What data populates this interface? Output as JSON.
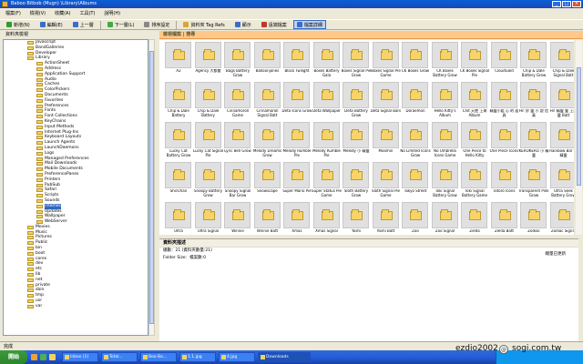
{
  "window": {
    "title": "Baboo Bitbob (Mugn) \\Library\\Albums"
  },
  "menu": [
    "檔案(F)",
    "檢視(V)",
    "收藏(A)",
    "工具(T)",
    "說明(H)"
  ],
  "toolbar": [
    {
      "label": "新增(N)",
      "icon": "new-icon",
      "color": "#2e9b2e"
    },
    {
      "label": "編輯(E)",
      "icon": "edit-icon",
      "color": "#3b6cc8"
    },
    {
      "label": "上一層",
      "icon": "up-icon",
      "color": "#3b6cc8"
    },
    {
      "label": "下一層(L)",
      "icon": "down-icon",
      "color": "#4a4"
    },
    {
      "label": "排序設定",
      "icon": "sort-icon",
      "color": "#888"
    },
    {
      "label": "資料夾 Tag Refs",
      "icon": "folder-tag-icon",
      "color": "#d9a630"
    },
    {
      "label": "顯示",
      "icon": "view-icon",
      "color": "#3b6cc8"
    },
    {
      "label": "遠端檔案",
      "icon": "remote-icon",
      "color": "#c0392b"
    },
    {
      "label": "檔案詳細",
      "icon": "details-icon",
      "color": "#3b6cc8"
    }
  ],
  "sidebar": {
    "title": "資料夾檢視",
    "items": [
      {
        "label": "Javascript",
        "level": 0
      },
      {
        "label": "BandGalleries",
        "level": 0
      },
      {
        "label": "Developer",
        "level": 0
      },
      {
        "label": "Library",
        "level": 0
      },
      {
        "label": "ActionSheet",
        "level": 1
      },
      {
        "label": "Address",
        "level": 1
      },
      {
        "label": "Application Support",
        "level": 1
      },
      {
        "label": "Audio",
        "level": 1
      },
      {
        "label": "Caches",
        "level": 1
      },
      {
        "label": "ColorPickers",
        "level": 1
      },
      {
        "label": "Documents",
        "level": 1
      },
      {
        "label": "Favorites",
        "level": 1
      },
      {
        "label": "Preferences",
        "level": 1
      },
      {
        "label": "Fonts",
        "level": 1
      },
      {
        "label": "Font Collections",
        "level": 1
      },
      {
        "label": "KeyChains",
        "level": 1
      },
      {
        "label": "Input Methods",
        "level": 1
      },
      {
        "label": "Internet Plug-Ins",
        "level": 1
      },
      {
        "label": "Keyboard Layouts",
        "level": 1
      },
      {
        "label": "Launch Agents",
        "level": 1
      },
      {
        "label": "LaunchDaemons",
        "level": 1
      },
      {
        "label": "Logs",
        "level": 1
      },
      {
        "label": "Managed Preferences",
        "level": 1
      },
      {
        "label": "Mail Downloads",
        "level": 1
      },
      {
        "label": "Mobile Documents",
        "level": 1
      },
      {
        "label": "PreferencePanes",
        "level": 1
      },
      {
        "label": "Printers",
        "level": 1
      },
      {
        "label": "PubSub",
        "level": 1
      },
      {
        "label": "Safari",
        "level": 1
      },
      {
        "label": "Scripts",
        "level": 1
      },
      {
        "label": "Sounds",
        "level": 1
      },
      {
        "label": "Themes",
        "level": 1
      },
      {
        "label": "Updates",
        "level": 1
      },
      {
        "label": "Wallpaper",
        "level": 1
      },
      {
        "label": "WebServer",
        "level": 1
      },
      {
        "label": "Movies",
        "level": 0
      },
      {
        "label": "Music",
        "level": 0
      },
      {
        "label": "Pictures",
        "level": 0
      },
      {
        "label": "Public",
        "level": 0
      },
      {
        "label": "bin",
        "level": 0
      },
      {
        "label": "boot",
        "level": 0
      },
      {
        "label": "cores",
        "level": 0
      },
      {
        "label": "dev",
        "level": 0
      },
      {
        "label": "etc",
        "level": 0
      },
      {
        "label": "lib",
        "level": 0
      },
      {
        "label": "net",
        "level": 0
      },
      {
        "label": "private",
        "level": 0
      },
      {
        "label": "sbin",
        "level": 0
      },
      {
        "label": "tmp",
        "level": 0
      },
      {
        "label": "usr",
        "level": 0
      },
      {
        "label": "var",
        "level": 0
      }
    ],
    "selected": 31
  },
  "tabs": {
    "label": "檢視檔案 | 搜尋"
  },
  "grid": {
    "items": [
      "A2",
      "Agency 大都會",
      "Bags Battery Grow",
      "Balloonjones",
      "Black Twilight",
      "Boxes Battery Gala",
      "Boxes Signal Pie Grow",
      "Boxes Signal Pie Game",
      "CK Boxes Grow",
      "CK Boxes Battery Grow",
      "CK Boxes Signal Pie",
      "CloudGold",
      "Chip & Dale Battery Grow",
      "Chip & Dale Signal Batt",
      "Chip & Dale Battery",
      "Chip & Dale Battery",
      "Cinnamoroll Game",
      "Cinnamoroll Signal Batt",
      "Deta Icons Grow",
      "Deta Wallpaper",
      "Deta Battery Grow",
      "Deta Signal Bars",
      "Doraemon",
      "Hello Kitty's Album",
      "Chit 天使 上海 Album",
      "精靈小姐 心 的 面具",
      "Hi! 妙 靈 小 說 信 真",
      "Hi! 精靈 靈 上海 靈 Batt",
      "Lucky Cat Battery Grow",
      "Lucky Cat Signal Pie",
      "Lyric Bell Grow",
      "Melody Dreams Grow",
      "Melody Rumble Pie",
      "Melody Rumble Pie",
      "Melody 小 精靈",
      "Moomin",
      "No Limited Icons Grow",
      "No Umbrella Icons Game",
      "One Piece to Hello Kitty",
      "One Piece Icons",
      "KEROKERO 小 精靈",
      "Rainbow Bar 小 精靈",
      "Shinchan",
      "Snoopy Battery Grow",
      "Snoopy Signal Bar Grow",
      "Snowscape",
      "Super Mario Pie",
      "Super Status Pie Game",
      "Sloth Battery Grow",
      "Sloth Signal Pie Game",
      "Tokyo Street",
      "Toki Signal Battery Grow",
      "Toki Signal Battery Game",
      "Totoro Icons",
      "Transparent Pink Grow",
      "Ultra Seek Battery Grow",
      "Ultra",
      "Ultra Signal",
      "Winnie",
      "Winnie Batt",
      "Xmas",
      "Xmas Signal",
      "Yoshi",
      "Yoshi Batt",
      "Zoo",
      "Zoo Signal",
      "Zelda",
      "Zelda Batt",
      "Zodiac",
      "Zodiac Signal"
    ]
  },
  "info": {
    "title": "資料夾描述",
    "lines": [
      "總數：21 (資料夾數量:21)",
      "Folder Size：檔案數:0"
    ],
    "right": "總量已更新"
  },
  "status": {
    "text": "完成"
  },
  "taskbar": {
    "start": "開始",
    "tasks": [
      "Inbox (1)",
      "Total...",
      "Boo Bo...",
      "1.1.jpg",
      "4.jpg",
      "Downloads"
    ],
    "active_task": "Downloads"
  },
  "watermark": {
    "user": "ezdio2002",
    "site": "sogi.com.tw",
    "badge": "@"
  }
}
